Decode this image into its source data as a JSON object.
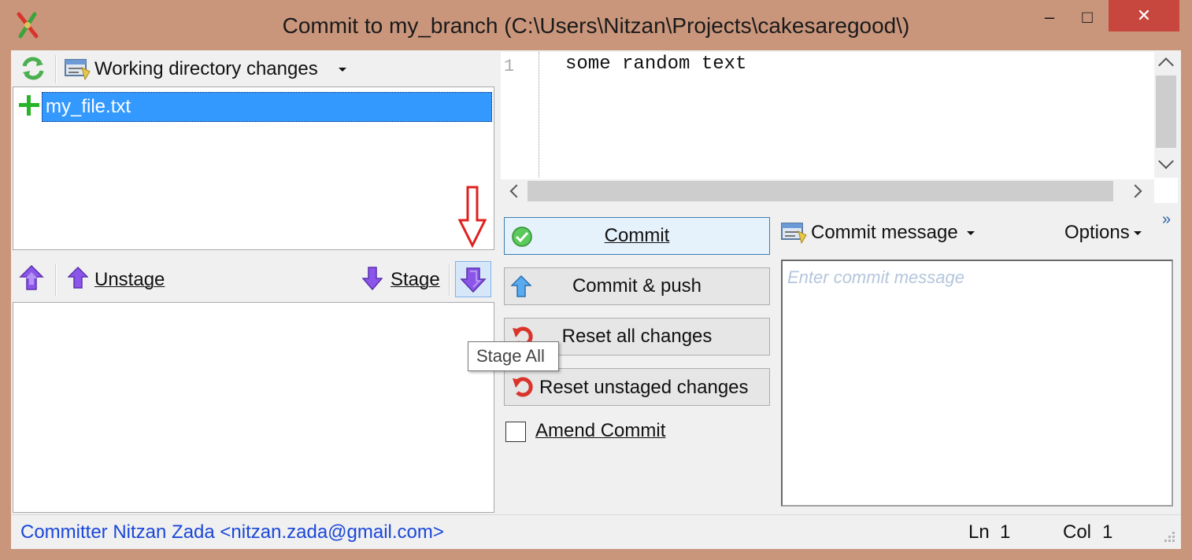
{
  "window": {
    "title": "Commit to my_branch (C:\\Users\\Nitzan\\Projects\\cakesaregood\\)",
    "accent": "#c9967c",
    "controls": {
      "minimize": "–",
      "maximize": "□",
      "close": "✕"
    }
  },
  "unstaged": {
    "dropdown_label": "Working directory changes",
    "files": [
      {
        "name": "my_file.txt",
        "status": "added"
      }
    ]
  },
  "stage_toolbar": {
    "unstage_label": "Unstage",
    "stage_label": "Stage",
    "tooltip": "Stage All"
  },
  "diff": {
    "line_number": "1",
    "line_text": "some random text"
  },
  "actions": {
    "commit": "Commit",
    "commit_push": "Commit & push",
    "reset_all": "Reset all changes",
    "reset_unstaged": "Reset unstaged changes",
    "amend_label": "Amend Commit",
    "amend_checked": false
  },
  "message": {
    "dropdown_label": "Commit message",
    "options_label": "Options",
    "overflow": "»",
    "placeholder": "Enter commit message"
  },
  "status": {
    "committer": "Committer Nitzan Zada <nitzan.zada@gmail.com>",
    "ln_label": "Ln",
    "ln_value": "1",
    "col_label": "Col",
    "col_value": "1"
  }
}
